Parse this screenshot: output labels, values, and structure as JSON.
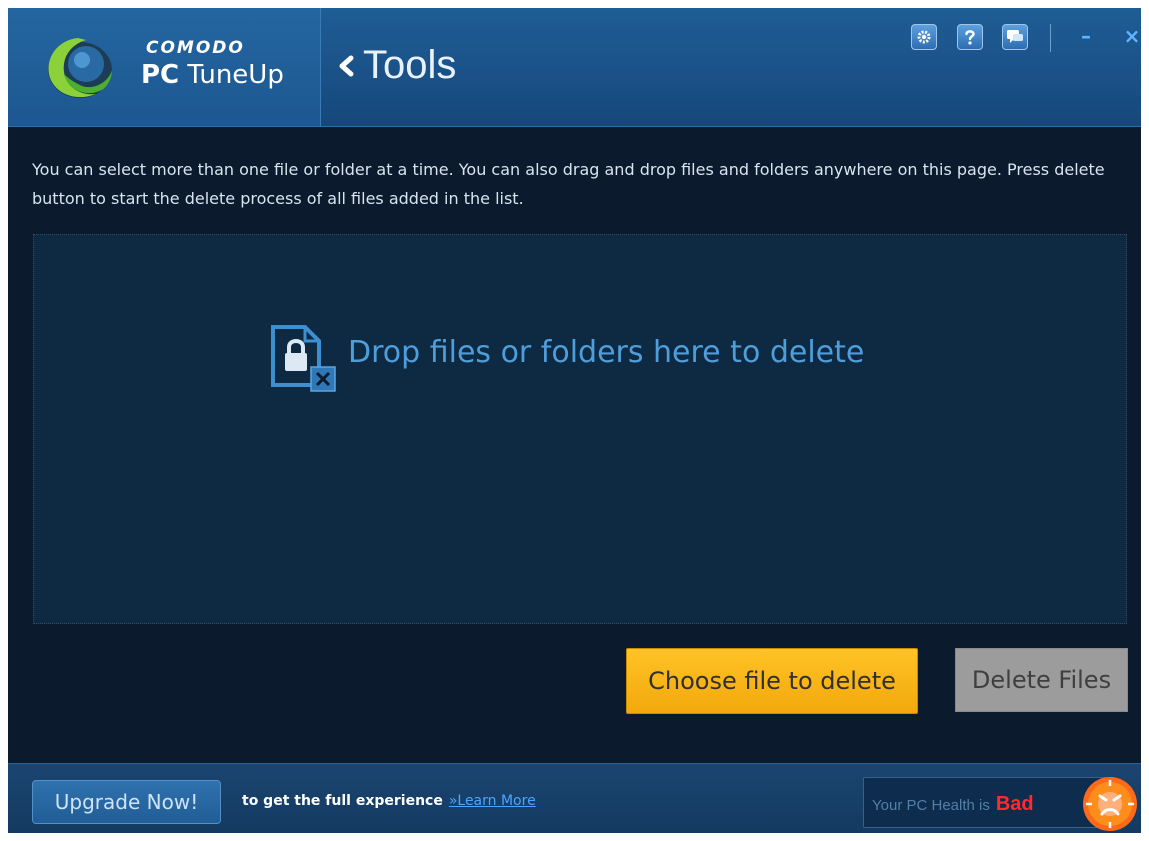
{
  "header": {
    "brand_top": "COMODO",
    "brand_bold": "PC",
    "brand_rest": "TuneUp",
    "title": "Tools",
    "icons": [
      "gear-icon",
      "help-icon",
      "chat-icon",
      "minimize-icon",
      "close-icon"
    ],
    "minimize_glyph": "–",
    "close_glyph": "×"
  },
  "main": {
    "instructions": "You can select more than one file or folder at a time. You can also drag and drop files and folders anywhere on this page. Press delete button to start the delete process of all files added in the list.",
    "dropzone_text": "Drop files or folders here to delete",
    "choose_button": "Choose file to delete",
    "delete_button": "Delete Files"
  },
  "footer": {
    "upgrade_button": "Upgrade Now!",
    "message": "to get the full experience",
    "learn_more": "»Learn More",
    "health_label": "Your PC Health is",
    "health_status": "Bad"
  },
  "colors": {
    "accent_yellow": "#f2a80b",
    "health_bad": "#ff2a2a",
    "link_blue": "#4fa3ff",
    "header_blue": "#1a5288",
    "background": "#0b1a2c"
  }
}
